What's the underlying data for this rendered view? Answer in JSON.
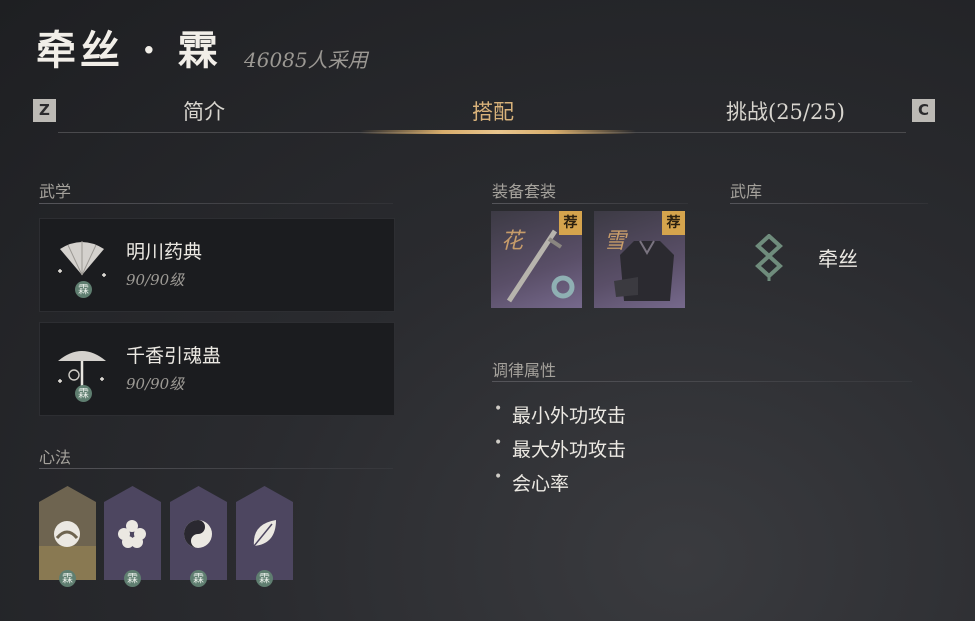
{
  "header": {
    "title": "牵丝 · 霖",
    "adopted": "46085人采用"
  },
  "tabs": {
    "prev_key": "Z",
    "next_key": "C",
    "items": [
      "简介",
      "搭配",
      "挑战(25/25)"
    ],
    "active_index": 1
  },
  "martial": {
    "section": "武学",
    "skills": [
      {
        "name": "明川药典",
        "level": "90/90级",
        "badge": "霖"
      },
      {
        "name": "千香引魂蛊",
        "level": "90/90级",
        "badge": "霖"
      }
    ]
  },
  "mind": {
    "section": "心法",
    "badges": [
      "霖",
      "霖",
      "霖",
      "霖"
    ]
  },
  "equipment": {
    "section": "装备套装",
    "sets": [
      {
        "char": "花",
        "tag": "荐"
      },
      {
        "char": "雪",
        "tag": "荐"
      }
    ]
  },
  "armory": {
    "section": "武库",
    "weapon": "牵丝"
  },
  "attributes": {
    "section": "调律属性",
    "items": [
      "最小外功攻击",
      "最大外功攻击",
      "会心率"
    ]
  },
  "colors": {
    "accent": "#d8ad6c",
    "badge": "#5f7e70",
    "recommend": "#d5a44d"
  }
}
